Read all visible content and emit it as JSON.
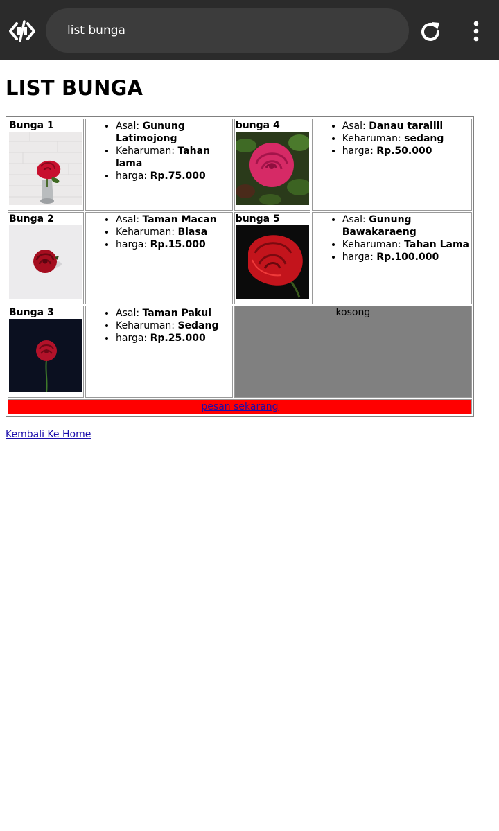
{
  "browser": {
    "url_text": "list bunga"
  },
  "page": {
    "title": "LIST BUNGA",
    "labels": {
      "asal": "Asal: ",
      "keharuman": "Keharuman: ",
      "harga": "harga: "
    },
    "flowers": [
      {
        "name": "Bunga 1",
        "asal": "Gunung Latimojong",
        "keharuman": "Tahan lama",
        "harga": "Rp.75.000"
      },
      {
        "name": "bunga 4",
        "asal": "Danau taralili",
        "keharuman": "sedang",
        "harga": "Rp.50.000"
      },
      {
        "name": "Bunga 2",
        "asal": "Taman Macan",
        "keharuman": "Biasa",
        "harga": "Rp.15.000"
      },
      {
        "name": "bunga 5",
        "asal": "Gunung Bawakaraeng",
        "keharuman": "Tahan Lama",
        "harga": "Rp.100.000"
      },
      {
        "name": "Bunga 3",
        "asal": "Taman Pakui",
        "keharuman": "Sedang",
        "harga": "Rp.25.000"
      }
    ],
    "empty_text": "kosong",
    "order_link": "pesan sekarang",
    "home_link": "Kembali Ke Home"
  },
  "colors": {
    "topbar": "#2b2b2b",
    "order_bar": "#ff0000",
    "empty_cell": "#808080",
    "link": "#1a0dab"
  }
}
